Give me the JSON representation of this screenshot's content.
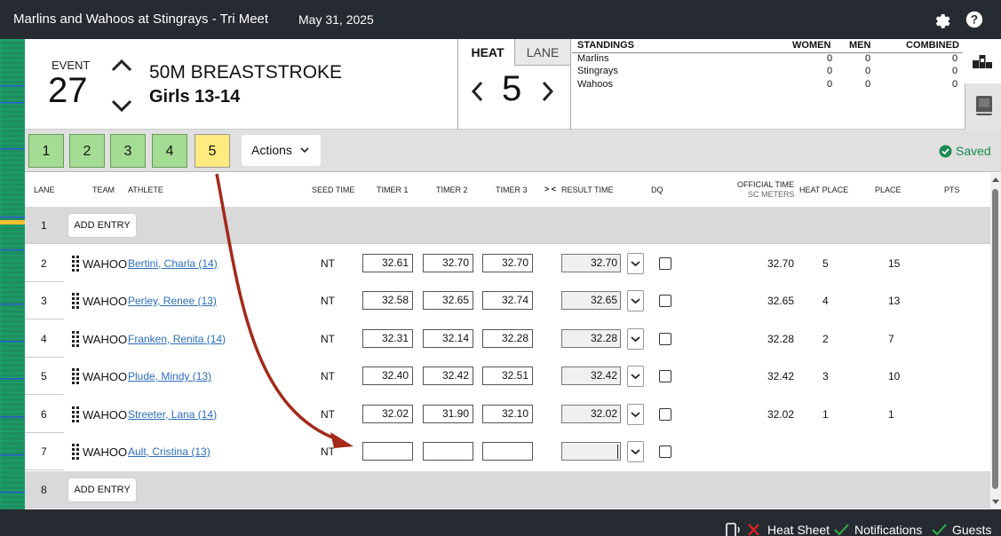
{
  "header": {
    "title": "Marlins and Wahoos at Stingrays - Tri Meet",
    "date": "May 31, 2025",
    "settings_icon": "gear-icon",
    "help_icon": "help-icon"
  },
  "event": {
    "label": "EVENT",
    "number": "27",
    "name": "50M BREASTSTROKE",
    "group": "Girls 13-14"
  },
  "heat_panel": {
    "heat_tab": "HEAT",
    "lane_tab": "LANE",
    "current_heat": "5"
  },
  "standings": {
    "title": "STANDINGS",
    "columns": [
      "WOMEN",
      "MEN",
      "COMBINED"
    ],
    "rows": [
      {
        "team": "Marlins",
        "women": "0",
        "men": "0",
        "combined": "0"
      },
      {
        "team": "Stingrays",
        "women": "0",
        "men": "0",
        "combined": "0"
      },
      {
        "team": "Wahoos",
        "women": "0",
        "men": "0",
        "combined": "0"
      }
    ]
  },
  "heat_buttons": [
    "1",
    "2",
    "3",
    "4",
    "5"
  ],
  "current_heat_button": "5",
  "actions_label": "Actions",
  "saved_label": "Saved",
  "columns": {
    "lane": "LANE",
    "team": "TEAM",
    "athlete": "ATHLETE",
    "seed": "SEED TIME",
    "t1": "TIMER 1",
    "t2": "TIMER 2",
    "t3": "TIMER 3",
    "swap": "> <",
    "result": "RESULT TIME",
    "dq": "DQ",
    "official": "OFFICIAL TIME",
    "official_sub": "SC METERS",
    "heat_place": "HEAT PLACE",
    "place": "PLACE",
    "pts": "PTS"
  },
  "add_entry_label": "ADD ENTRY",
  "lanes": [
    {
      "lane": "1",
      "empty": true
    },
    {
      "lane": "2",
      "team": "WAHOO",
      "athlete": "Bertini, Charla (14)",
      "seed": "NT",
      "t1": "32.61",
      "t2": "32.70",
      "t3": "32.70",
      "result": "32.70",
      "official": "32.70",
      "heat_place": "5",
      "place": "15"
    },
    {
      "lane": "3",
      "team": "WAHOO",
      "athlete": "Perley, Renee (13)",
      "seed": "NT",
      "t1": "32.58",
      "t2": "32.65",
      "t3": "32.74",
      "result": "32.65",
      "official": "32.65",
      "heat_place": "4",
      "place": "13"
    },
    {
      "lane": "4",
      "team": "WAHOO",
      "athlete": "Franken, Renita (14)",
      "seed": "NT",
      "t1": "32.31",
      "t2": "32.14",
      "t3": "32.28",
      "result": "32.28",
      "official": "32.28",
      "heat_place": "2",
      "place": "7"
    },
    {
      "lane": "5",
      "team": "WAHOO",
      "athlete": "Plude, Mindy (13)",
      "seed": "NT",
      "t1": "32.40",
      "t2": "32.42",
      "t3": "32.51",
      "result": "32.42",
      "official": "32.42",
      "heat_place": "3",
      "place": "10"
    },
    {
      "lane": "6",
      "team": "WAHOO",
      "athlete": "Streeter, Lana (14)",
      "seed": "NT",
      "t1": "32.02",
      "t2": "31.90",
      "t3": "32.10",
      "result": "32.02",
      "official": "32.02",
      "heat_place": "1",
      "place": "1"
    },
    {
      "lane": "7",
      "team": "WAHOO",
      "athlete": "Ault, Cristina (13)",
      "seed": "NT",
      "t1": "",
      "t2": "",
      "t3": "",
      "result": "",
      "official": "",
      "heat_place": "",
      "place": ""
    },
    {
      "lane": "8",
      "empty": true
    }
  ],
  "footer": {
    "heat_sheet": "Heat Sheet",
    "notifications": "Notifications",
    "guests": "Guests",
    "heat_sheet_status": "error",
    "notifications_status": "ok",
    "guests_status": "ok"
  },
  "colors": {
    "topbar": "#262b31",
    "heat_complete": "#a5dc94",
    "heat_current": "#ffeb80",
    "saved": "#1a8a55",
    "link": "#2a6ebf",
    "annotation_arrow": "#a32a1a"
  }
}
